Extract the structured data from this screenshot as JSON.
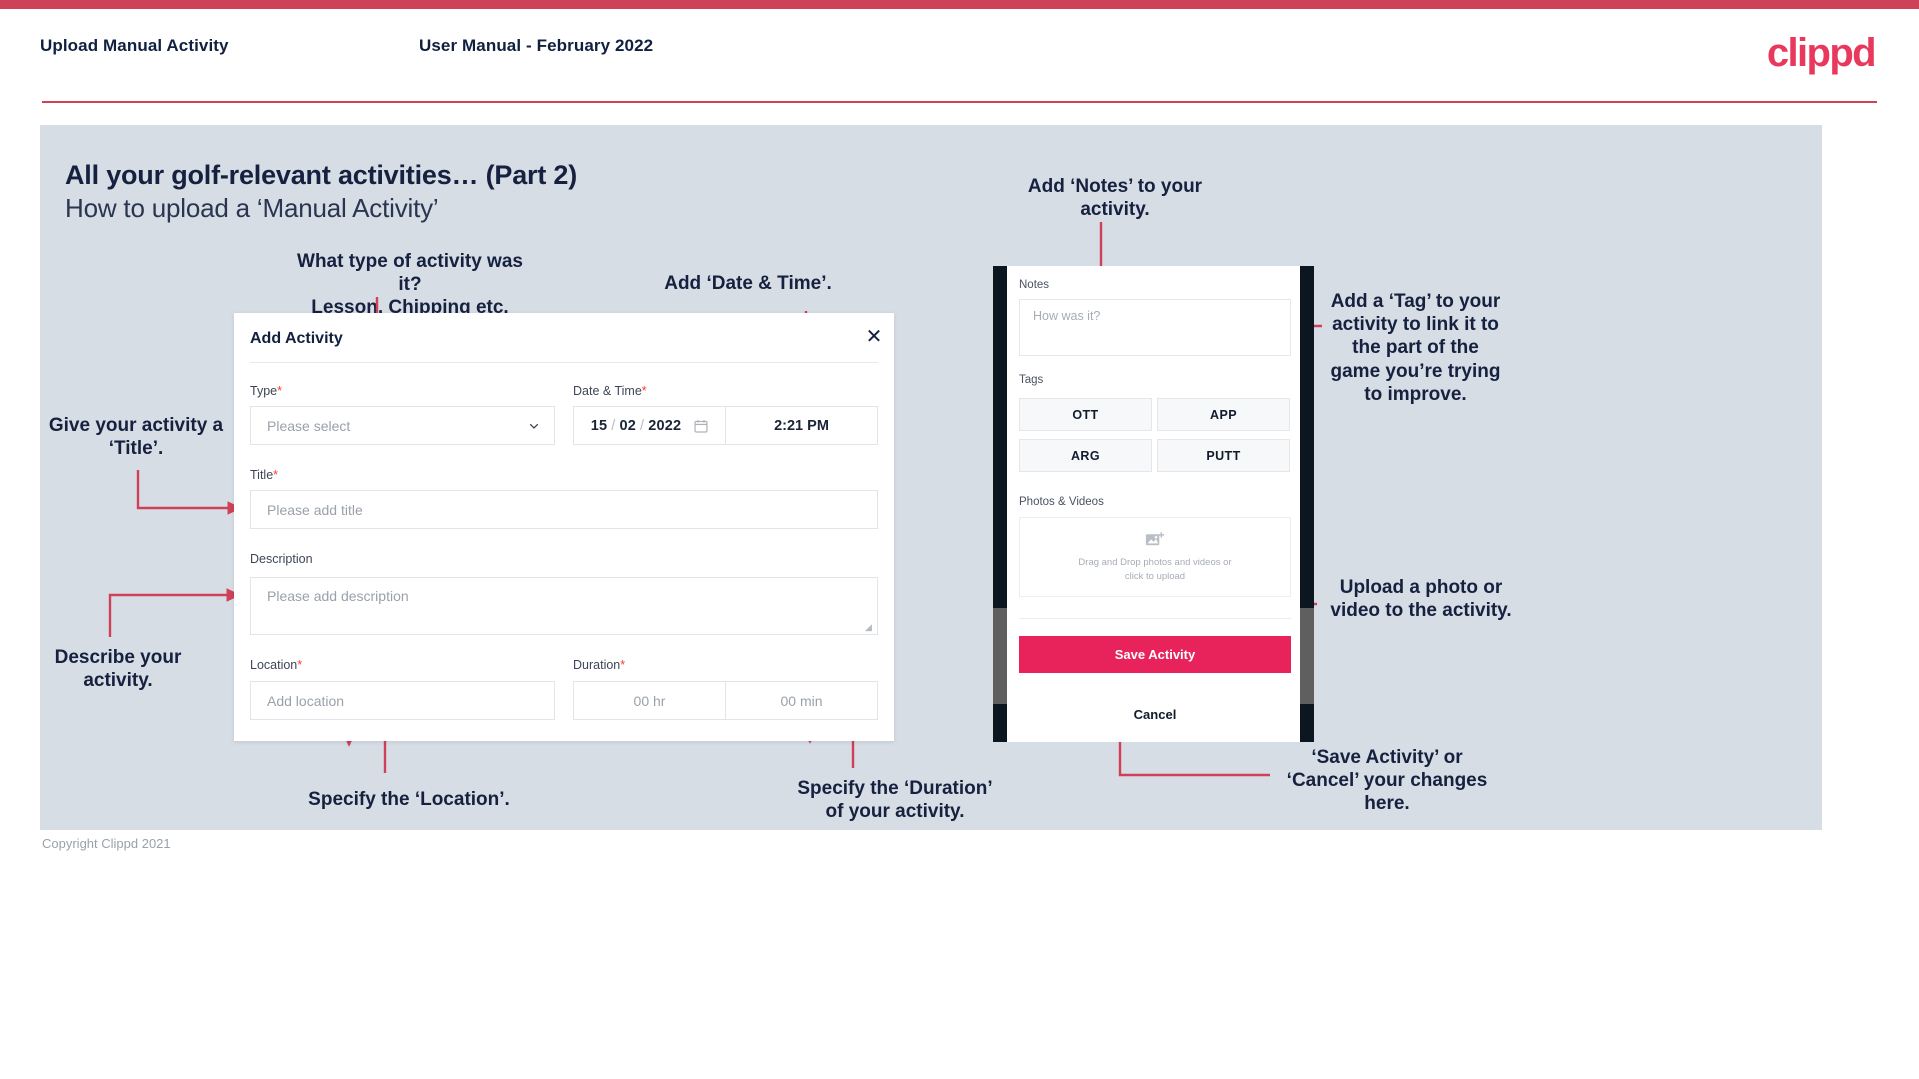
{
  "header": {
    "left_title": "Upload Manual Activity",
    "center_title": "User Manual - February 2022",
    "logo": "clippd"
  },
  "slide": {
    "title": "All your golf-relevant activities… (Part 2)",
    "subtitle": "How to upload a ‘Manual Activity’"
  },
  "dialog": {
    "title": "Add Activity",
    "close_icon": "✕",
    "fields": {
      "type": {
        "label": "Type",
        "required": "*",
        "placeholder": "Please select"
      },
      "datetime": {
        "label": "Date & Time",
        "required": "*",
        "day": "15",
        "month": "02",
        "year": "2022",
        "separator": "/",
        "time": "2:21 PM"
      },
      "title": {
        "label": "Title",
        "required": "*",
        "placeholder": "Please add title"
      },
      "description": {
        "label": "Description",
        "required": "",
        "placeholder": "Please add description"
      },
      "location": {
        "label": "Location",
        "required": "*",
        "placeholder": "Add location"
      },
      "duration": {
        "label": "Duration",
        "required": "*",
        "hours": "00 hr",
        "minutes": "00 min"
      }
    }
  },
  "phone": {
    "notes": {
      "label": "Notes",
      "placeholder": "How was it?"
    },
    "tags": {
      "label": "Tags",
      "items": [
        "OTT",
        "APP",
        "ARG",
        "PUTT"
      ]
    },
    "photos": {
      "label": "Photos & Videos",
      "drop_line1": "Drag and Drop photos and videos or",
      "drop_line2": "click to upload"
    },
    "save_label": "Save Activity",
    "cancel_label": "Cancel"
  },
  "annotations": {
    "type": "What type of activity was it?\nLesson, Chipping etc.",
    "datetime": "Add ‘Date & Time’.",
    "notes": "Add ‘Notes’ to your\nactivity.",
    "tags": "Add a ‘Tag’ to your\nactivity to link it to\nthe part of the\ngame you’re trying\nto improve.",
    "title": "Give your activity a\n‘Title’.",
    "description": "Describe your\nactivity.",
    "location": "Specify the ‘Location’.",
    "duration": "Specify the ‘Duration’\nof your activity.",
    "upload": "Upload a photo or\nvideo to the activity.",
    "save": "‘Save Activity’ or\n‘Cancel’ your changes\nhere."
  },
  "footer": {
    "copyright": "Copyright Clippd 2021"
  },
  "colors": {
    "brand_pink": "#e8235c",
    "bar_red": "#cf4158",
    "panel_bg": "#d7dde5",
    "ink": "#16213f",
    "arrow": "#cf4158"
  }
}
